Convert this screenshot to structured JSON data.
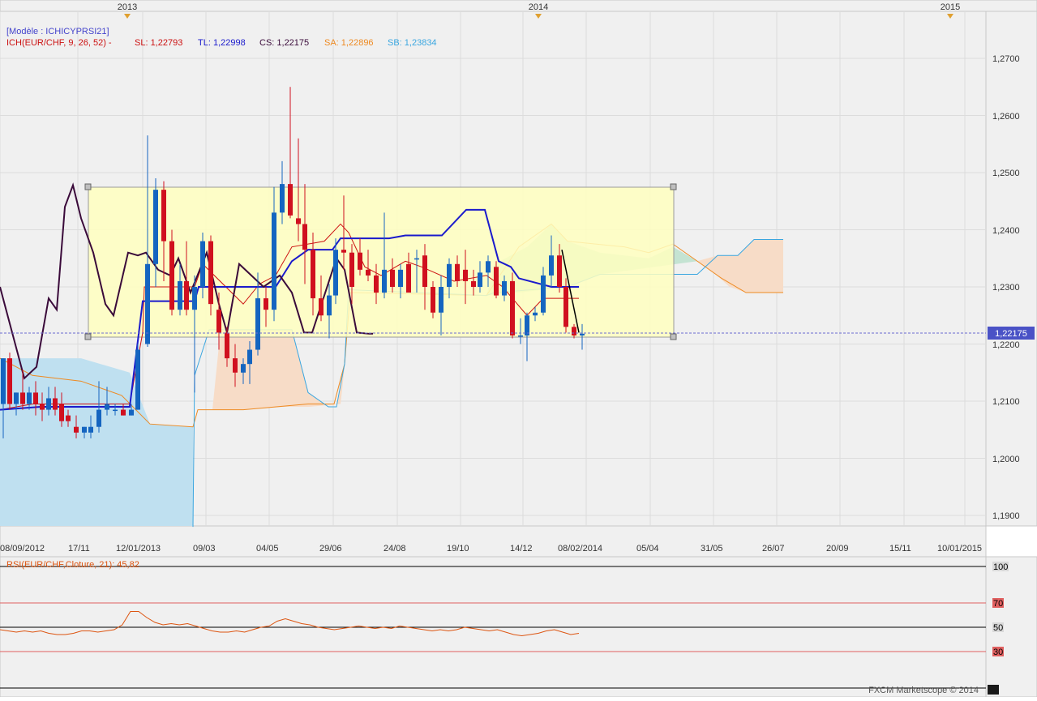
{
  "header": {
    "model_label": "[Modèle : ICHICYPRSI21]",
    "indicator_label": "ICH(EUR/CHF, 9, 26, 52) -",
    "sl_label": "SL: 1,22793",
    "tl_label": "TL: 1,22998",
    "cs_label": "CS: 1,22175",
    "sa_label": "SA: 1,22896",
    "sb_label": "SB: 1,23834"
  },
  "year_markers": [
    "2013",
    "2014",
    "2015"
  ],
  "x_axis_labels": [
    "08/09/2012",
    "17/11",
    "12/01/2013",
    "09/03",
    "04/05",
    "29/06",
    "24/08",
    "19/10",
    "14/12",
    "08/02/2014",
    "05/04",
    "31/05",
    "26/07",
    "20/09",
    "15/11",
    "10/01/2015"
  ],
  "y_axis_labels": [
    "1,2700",
    "1,2600",
    "1,2500",
    "1,2400",
    "1,2300",
    "1,2200",
    "1,2100",
    "1,2000",
    "1,1900"
  ],
  "current_price_label": "1,22175",
  "rsi": {
    "label": "RSI(EUR/CHF,Cloture, 21): 45,82",
    "levels": [
      "100",
      "70",
      "50",
      "30"
    ],
    "values": [
      48,
      47,
      46,
      47,
      46,
      47,
      45,
      44,
      44,
      45,
      47,
      47,
      46,
      47,
      48,
      52,
      63,
      63,
      58,
      54,
      52,
      53,
      52,
      53,
      51,
      49,
      47,
      46,
      46,
      47,
      46,
      48,
      50,
      51,
      55,
      57,
      55,
      53,
      52,
      50,
      49,
      48,
      49,
      50,
      51,
      50,
      49,
      50,
      49,
      51,
      50,
      49,
      48,
      47,
      48,
      47,
      48,
      50,
      49,
      48,
      47,
      48,
      46,
      44,
      43,
      44,
      45,
      47,
      48,
      46,
      44,
      45
    ]
  },
  "watermark": "FXCM Marketscope © 2014",
  "colors": {
    "background": "#f0f0f0",
    "bull_candle": "#1565c0",
    "bear_candle": "#d0101f",
    "tenkan": "#cc1111",
    "kijun": "#1a1acc",
    "chikou": "#3a0a3a",
    "senkou_a": "#ee8a22",
    "senkou_b": "#3aa6e0",
    "cloud_bull": "#bfe0f0",
    "cloud_bear": "#f7dcc7",
    "rectangle_fill": "#ffffc0",
    "rsi_line": "#dd5511"
  },
  "chart_data": {
    "type": "candlestick",
    "instrument": "EUR/CHF",
    "ylim": [
      1.186,
      1.2775
    ],
    "candles": [
      {
        "x": 0,
        "o": 1.2095,
        "h": 1.2175,
        "l": 1.2035,
        "c": 1.2175
      },
      {
        "x": 8,
        "o": 1.2175,
        "h": 1.2185,
        "l": 1.2085,
        "c": 1.2095
      },
      {
        "x": 16,
        "o": 1.2095,
        "h": 1.2115,
        "l": 1.2075,
        "c": 1.2115
      },
      {
        "x": 24,
        "o": 1.2115,
        "h": 1.2155,
        "l": 1.2085,
        "c": 1.2095
      },
      {
        "x": 32,
        "o": 1.2095,
        "h": 1.2125,
        "l": 1.2085,
        "c": 1.2115
      },
      {
        "x": 40,
        "o": 1.2115,
        "h": 1.2135,
        "l": 1.2075,
        "c": 1.2095
      },
      {
        "x": 48,
        "o": 1.2095,
        "h": 1.2115,
        "l": 1.2065,
        "c": 1.2085
      },
      {
        "x": 56,
        "o": 1.2085,
        "h": 1.2125,
        "l": 1.2075,
        "c": 1.2105
      },
      {
        "x": 64,
        "o": 1.2105,
        "h": 1.2125,
        "l": 1.2075,
        "c": 1.2085
      },
      {
        "x": 72,
        "o": 1.2095,
        "h": 1.2115,
        "l": 1.2055,
        "c": 1.2065
      },
      {
        "x": 80,
        "o": 1.2075,
        "h": 1.2085,
        "l": 1.2055,
        "c": 1.2065
      },
      {
        "x": 90,
        "o": 1.2055,
        "h": 1.2075,
        "l": 1.2035,
        "c": 1.2045
      },
      {
        "x": 100,
        "o": 1.2045,
        "h": 1.2055,
        "l": 1.2035,
        "c": 1.2055
      },
      {
        "x": 108,
        "o": 1.2045,
        "h": 1.2075,
        "l": 1.2035,
        "c": 1.2055
      },
      {
        "x": 118,
        "o": 1.2055,
        "h": 1.2135,
        "l": 1.2045,
        "c": 1.2085
      },
      {
        "x": 128,
        "o": 1.2085,
        "h": 1.2125,
        "l": 1.2075,
        "c": 1.2095
      },
      {
        "x": 138,
        "o": 1.2085,
        "h": 1.2095,
        "l": 1.2075,
        "c": 1.2085
      },
      {
        "x": 148,
        "o": 1.2085,
        "h": 1.2095,
        "l": 1.2075,
        "c": 1.2075
      },
      {
        "x": 158,
        "o": 1.2075,
        "h": 1.2095,
        "l": 1.2075,
        "c": 1.2085
      },
      {
        "x": 166,
        "o": 1.2085,
        "h": 1.22,
        "l": 1.2085,
        "c": 1.219
      },
      {
        "x": 178,
        "o": 1.22,
        "h": 1.2565,
        "l": 1.2195,
        "c": 1.234
      },
      {
        "x": 188,
        "o": 1.234,
        "h": 1.249,
        "l": 1.23,
        "c": 1.247
      },
      {
        "x": 198,
        "o": 1.247,
        "h": 1.2485,
        "l": 1.231,
        "c": 1.238
      },
      {
        "x": 208,
        "o": 1.238,
        "h": 1.24,
        "l": 1.225,
        "c": 1.226
      },
      {
        "x": 218,
        "o": 1.226,
        "h": 1.234,
        "l": 1.225,
        "c": 1.231
      },
      {
        "x": 226,
        "o": 1.231,
        "h": 1.238,
        "l": 1.225,
        "c": 1.226
      },
      {
        "x": 236,
        "o": 1.226,
        "h": 1.232,
        "l": 1.2115,
        "c": 1.23
      },
      {
        "x": 246,
        "o": 1.23,
        "h": 1.2395,
        "l": 1.228,
        "c": 1.238
      },
      {
        "x": 256,
        "o": 1.238,
        "h": 1.239,
        "l": 1.225,
        "c": 1.227
      },
      {
        "x": 266,
        "o": 1.226,
        "h": 1.229,
        "l": 1.219,
        "c": 1.222
      },
      {
        "x": 276,
        "o": 1.222,
        "h": 1.223,
        "l": 1.216,
        "c": 1.2175
      },
      {
        "x": 286,
        "o": 1.2175,
        "h": 1.22,
        "l": 1.2125,
        "c": 1.215
      },
      {
        "x": 296,
        "o": 1.215,
        "h": 1.2175,
        "l": 1.213,
        "c": 1.2165
      },
      {
        "x": 304,
        "o": 1.2165,
        "h": 1.2205,
        "l": 1.213,
        "c": 1.219
      },
      {
        "x": 314,
        "o": 1.219,
        "h": 1.2325,
        "l": 1.218,
        "c": 1.228
      },
      {
        "x": 324,
        "o": 1.228,
        "h": 1.23,
        "l": 1.223,
        "c": 1.226
      },
      {
        "x": 334,
        "o": 1.226,
        "h": 1.2475,
        "l": 1.224,
        "c": 1.243
      },
      {
        "x": 344,
        "o": 1.243,
        "h": 1.252,
        "l": 1.241,
        "c": 1.248
      },
      {
        "x": 354,
        "o": 1.248,
        "h": 1.265,
        "l": 1.242,
        "c": 1.2425
      },
      {
        "x": 364,
        "o": 1.242,
        "h": 1.256,
        "l": 1.238,
        "c": 1.241
      },
      {
        "x": 372,
        "o": 1.241,
        "h": 1.248,
        "l": 1.2305,
        "c": 1.2365
      },
      {
        "x": 382,
        "o": 1.2365,
        "h": 1.2395,
        "l": 1.225,
        "c": 1.228
      },
      {
        "x": 392,
        "o": 1.228,
        "h": 1.232,
        "l": 1.224,
        "c": 1.225
      },
      {
        "x": 402,
        "o": 1.225,
        "h": 1.2305,
        "l": 1.221,
        "c": 1.2285
      },
      {
        "x": 410,
        "o": 1.2285,
        "h": 1.2385,
        "l": 1.227,
        "c": 1.2365
      },
      {
        "x": 420,
        "o": 1.2365,
        "h": 1.246,
        "l": 1.233,
        "c": 1.236
      },
      {
        "x": 430,
        "o": 1.236,
        "h": 1.2375,
        "l": 1.227,
        "c": 1.23
      },
      {
        "x": 440,
        "o": 1.236,
        "h": 1.2385,
        "l": 1.232,
        "c": 1.233
      },
      {
        "x": 450,
        "o": 1.233,
        "h": 1.2365,
        "l": 1.231,
        "c": 1.232
      },
      {
        "x": 460,
        "o": 1.232,
        "h": 1.234,
        "l": 1.227,
        "c": 1.229
      },
      {
        "x": 470,
        "o": 1.229,
        "h": 1.243,
        "l": 1.228,
        "c": 1.233
      },
      {
        "x": 480,
        "o": 1.233,
        "h": 1.235,
        "l": 1.229,
        "c": 1.23
      },
      {
        "x": 490,
        "o": 1.23,
        "h": 1.234,
        "l": 1.228,
        "c": 1.233
      },
      {
        "x": 500,
        "o": 1.234,
        "h": 1.236,
        "l": 1.229,
        "c": 1.229
      },
      {
        "x": 510,
        "o": 1.235,
        "h": 1.2365,
        "l": 1.229,
        "c": 1.235
      },
      {
        "x": 520,
        "o": 1.2355,
        "h": 1.2375,
        "l": 1.226,
        "c": 1.23
      },
      {
        "x": 530,
        "o": 1.23,
        "h": 1.231,
        "l": 1.2245,
        "c": 1.2255
      },
      {
        "x": 540,
        "o": 1.2255,
        "h": 1.232,
        "l": 1.2215,
        "c": 1.23
      },
      {
        "x": 550,
        "o": 1.23,
        "h": 1.235,
        "l": 1.228,
        "c": 1.234
      },
      {
        "x": 560,
        "o": 1.234,
        "h": 1.2355,
        "l": 1.23,
        "c": 1.231
      },
      {
        "x": 570,
        "o": 1.233,
        "h": 1.2365,
        "l": 1.227,
        "c": 1.231
      },
      {
        "x": 580,
        "o": 1.231,
        "h": 1.233,
        "l": 1.2285,
        "c": 1.23
      },
      {
        "x": 588,
        "o": 1.23,
        "h": 1.2345,
        "l": 1.229,
        "c": 1.2325
      },
      {
        "x": 598,
        "o": 1.2325,
        "h": 1.2355,
        "l": 1.23,
        "c": 1.2345
      },
      {
        "x": 608,
        "o": 1.2335,
        "h": 1.2345,
        "l": 1.228,
        "c": 1.2285
      },
      {
        "x": 618,
        "o": 1.2285,
        "h": 1.232,
        "l": 1.2275,
        "c": 1.231
      },
      {
        "x": 628,
        "o": 1.231,
        "h": 1.2325,
        "l": 1.221,
        "c": 1.2215
      },
      {
        "x": 638,
        "o": 1.2215,
        "h": 1.2245,
        "l": 1.22,
        "c": 1.2215
      },
      {
        "x": 646,
        "o": 1.2215,
        "h": 1.2255,
        "l": 1.217,
        "c": 1.225
      },
      {
        "x": 656,
        "o": 1.225,
        "h": 1.2265,
        "l": 1.224,
        "c": 1.2255
      },
      {
        "x": 666,
        "o": 1.2255,
        "h": 1.2335,
        "l": 1.225,
        "c": 1.232
      },
      {
        "x": 676,
        "o": 1.232,
        "h": 1.239,
        "l": 1.23,
        "c": 1.2355
      },
      {
        "x": 686,
        "o": 1.2355,
        "h": 1.2375,
        "l": 1.229,
        "c": 1.23
      },
      {
        "x": 694,
        "o": 1.23,
        "h": 1.2315,
        "l": 1.222,
        "c": 1.223
      },
      {
        "x": 704,
        "o": 1.223,
        "h": 1.2235,
        "l": 1.221,
        "c": 1.2215
      },
      {
        "x": 714,
        "o": 1.2215,
        "h": 1.2235,
        "l": 1.219,
        "c": 1.2218
      }
    ]
  }
}
